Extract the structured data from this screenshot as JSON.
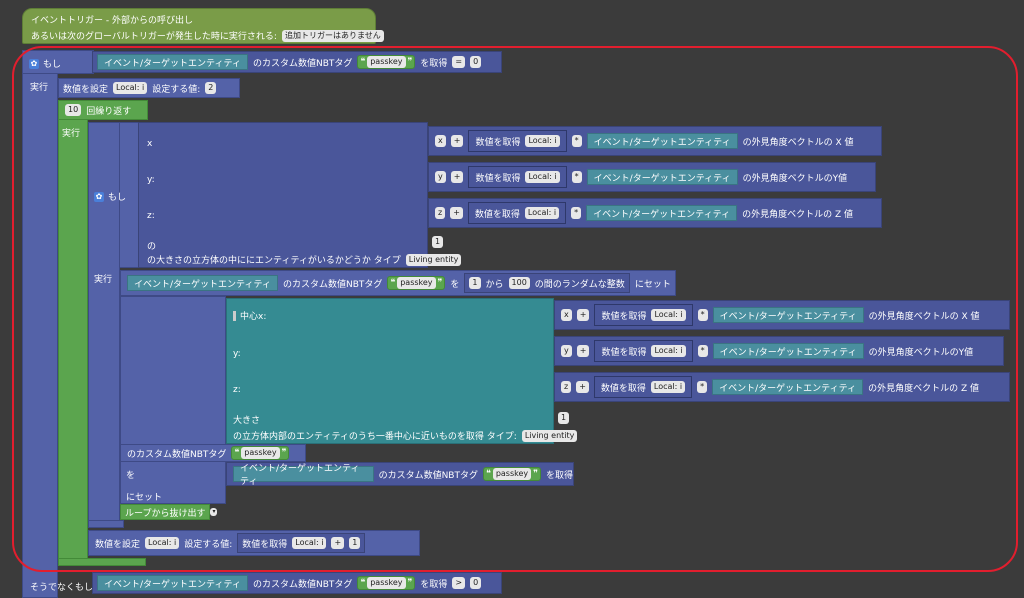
{
  "hat": {
    "line1": "イベントトリガー - 外部からの呼び出し",
    "line2": "あるいは次のグローバルトリガーが発生した時に実行される:",
    "trigger": "追加トリガーはありません"
  },
  "if1": {
    "label": "もし",
    "entity": "イベント/ターゲットエンティティ",
    "nbt": "のカスタム数値NBTタグ",
    "key": "passkey",
    "get": "を取得",
    "op": "=",
    "val": "0"
  },
  "exec": "実行",
  "set1": {
    "label": "数値を設定",
    "var": "Local: i",
    "assign": "設定する値:",
    "val": "2"
  },
  "rep": {
    "count": "10",
    "label": "回繰り返す"
  },
  "if2": {
    "label": "もし",
    "x": "x",
    "y": "y:",
    "z": "z:",
    "of": "の",
    "size_text": "の大きさの立方体の中ににエンティティがいるかどうか タイプ",
    "type": "Living entity",
    "size": "1"
  },
  "coords": [
    {
      "axis": "x",
      "op": "+",
      "getnum": "数値を取得",
      "var": "Local: i",
      "mul": "*",
      "entity": "イベント/ターゲットエンティティ",
      "suffix": "の外見角度ベクトルの X 値"
    },
    {
      "axis": "y",
      "op": "+",
      "getnum": "数値を取得",
      "var": "Local: i",
      "mul": "*",
      "entity": "イベント/ターゲットエンティティ",
      "suffix": "の外見角度ベクトルのY値"
    },
    {
      "axis": "z",
      "op": "+",
      "getnum": "数値を取得",
      "var": "Local: i",
      "mul": "*",
      "entity": "イベント/ターゲットエンティティ",
      "suffix": "の外見角度ベクトルの Z 値"
    }
  ],
  "setnbt": {
    "entity": "イベント/ターゲットエンティティ",
    "nbt": "のカスタム数値NBTタグ",
    "key": "passkey",
    "wo": "を",
    "from": "1",
    "kara": "から",
    "to": "100",
    "rand": "の間のランダムな整数",
    "set": "にセット"
  },
  "center": {
    "cx": "中心x:",
    "y": "y:",
    "z": "z:",
    "size": "大きさ",
    "sizeval": "1",
    "nearest": "の立方体内部のエンティティのうち一番中心に近いものを取得 タイプ:",
    "type": "Living entity"
  },
  "nbt2": {
    "nbt": "のカスタム数値NBTタグ",
    "key": "passkey",
    "wo": "を",
    "entity": "イベント/ターゲットエンティティ",
    "nbt_b": "のカスタム数値NBTタグ",
    "key_b": "passkey",
    "get": "を取得",
    "set": "にセット"
  },
  "brk": "ループから抜け出す",
  "set2": {
    "label": "数値を設定",
    "var": "Local: i",
    "assign": "設定する値:",
    "getnum": "数値を取得",
    "var2": "Local: i",
    "op": "+",
    "val": "1"
  },
  "else": {
    "label": "そうでなくもし",
    "entity": "イベント/ターゲットエンティティ",
    "nbt": "のカスタム数値NBTタグ",
    "key": "passkey",
    "get": "を取得",
    "op": ">",
    "val": "0"
  },
  "colors": {
    "highlight": "#e21e2e",
    "blue": "#5462a8",
    "green": "#5ba54e",
    "teal": "#4a8f9f"
  }
}
